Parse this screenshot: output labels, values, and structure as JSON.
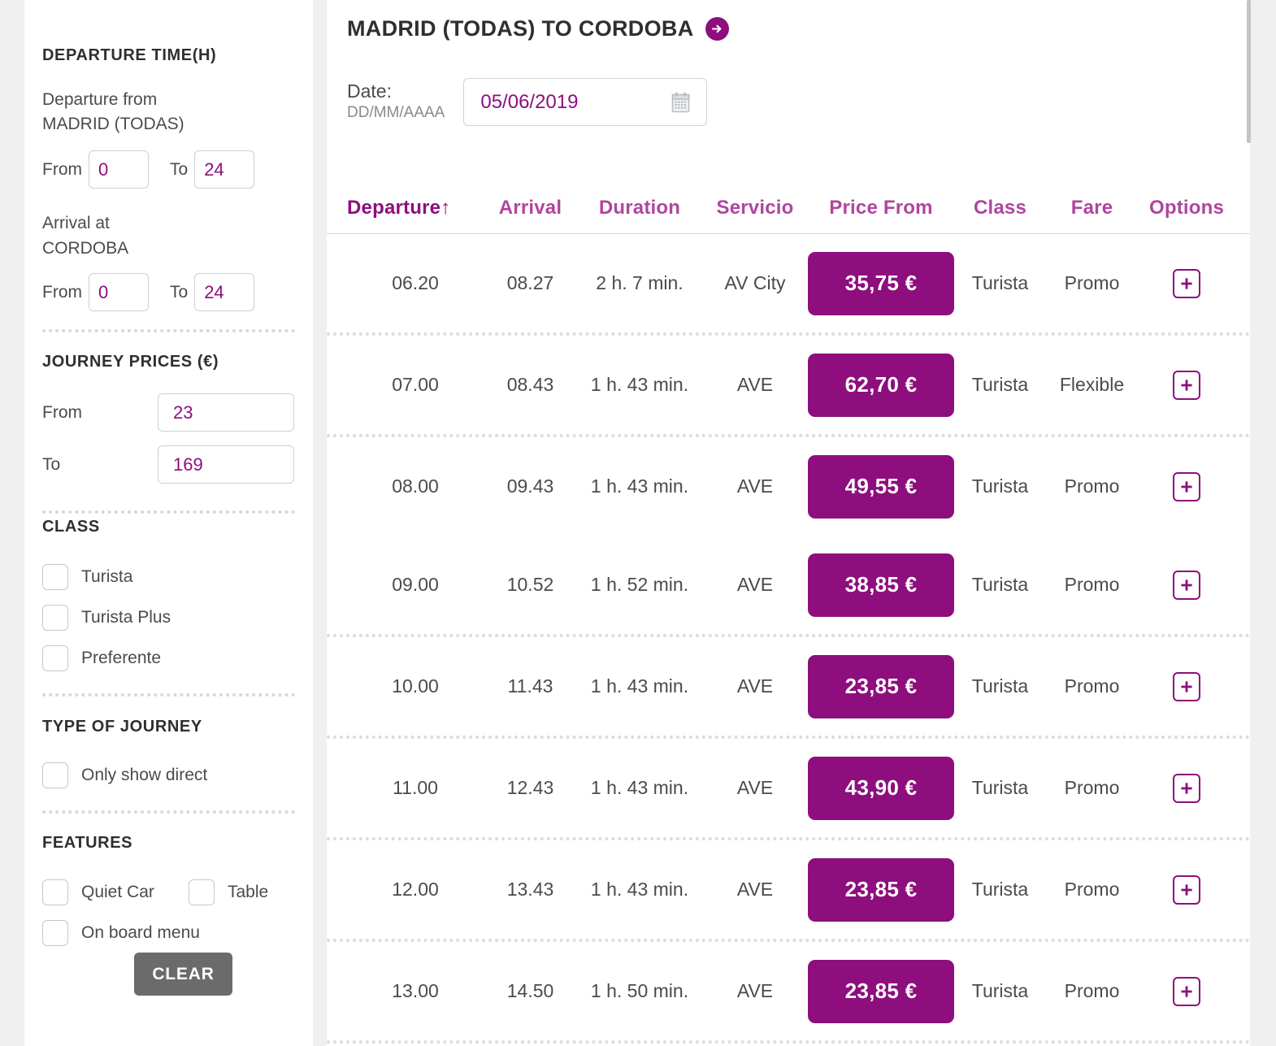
{
  "sidebar": {
    "departure_time": {
      "heading": "DEPARTURE TIME(H)",
      "departure_from_label": "Departure from",
      "departure_from_station": "MADRID (TODAS)",
      "dep_from_label": "From",
      "dep_from_value": "0",
      "dep_to_label": "To",
      "dep_to_value": "24",
      "arrival_at_label": "Arrival at",
      "arrival_at_station": "CORDOBA",
      "arr_from_label": "From",
      "arr_from_value": "0",
      "arr_to_label": "To",
      "arr_to_value": "24"
    },
    "journey_prices": {
      "heading": "JOURNEY PRICES (€)",
      "from_label": "From",
      "from_value": "23",
      "to_label": "To",
      "to_value": "169"
    },
    "class": {
      "heading": "CLASS",
      "options": [
        {
          "label": "Turista",
          "checked": false
        },
        {
          "label": "Turista Plus",
          "checked": false
        },
        {
          "label": "Preferente",
          "checked": false
        }
      ]
    },
    "type_of_journey": {
      "heading": "TYPE OF JOURNEY",
      "options": [
        {
          "label": "Only show direct",
          "checked": false
        }
      ]
    },
    "features": {
      "heading": "FEATURES",
      "options": [
        {
          "label": "Quiet Car",
          "checked": false
        },
        {
          "label": "Table",
          "checked": false
        },
        {
          "label": "On board menu",
          "checked": false
        }
      ]
    },
    "clear_button": "CLEAR"
  },
  "main": {
    "title": "MADRID (TODAS) TO CORDOBA",
    "title_arrow_icon": "arrow-right-circle-icon",
    "date": {
      "label_line1": "Date:",
      "label_line2": "DD/MM/AAAA",
      "value": "05/06/2019",
      "calendar_icon": "calendar-icon"
    },
    "table": {
      "headers": [
        {
          "label": "Departure",
          "sort": "↑",
          "active": true
        },
        {
          "label": "Arrival",
          "active": false
        },
        {
          "label": "Duration",
          "active": false
        },
        {
          "label": "Servicio",
          "active": false
        },
        {
          "label": "Price From",
          "active": false
        },
        {
          "label": "Class",
          "active": false
        },
        {
          "label": "Fare",
          "active": false
        },
        {
          "label": "Options",
          "active": false
        }
      ],
      "rows": [
        {
          "departure": "06.20",
          "arrival": "08.27",
          "duration": "2 h. 7 min.",
          "servicio": "AV City",
          "price": "35,75 €",
          "class": "Turista",
          "fare": "Promo",
          "options_icon": "plus-icon",
          "separator_after": true
        },
        {
          "departure": "07.00",
          "arrival": "08.43",
          "duration": "1 h. 43 min.",
          "servicio": "AVE",
          "price": "62,70 €",
          "class": "Turista",
          "fare": "Flexible",
          "options_icon": "plus-icon",
          "separator_after": true
        },
        {
          "departure": "08.00",
          "arrival": "09.43",
          "duration": "1 h. 43 min.",
          "servicio": "AVE",
          "price": "49,55 €",
          "class": "Turista",
          "fare": "Promo",
          "options_icon": "plus-icon",
          "separator_after": false
        },
        {
          "departure": "09.00",
          "arrival": "10.52",
          "duration": "1 h. 52 min.",
          "servicio": "AVE",
          "price": "38,85 €",
          "class": "Turista",
          "fare": "Promo",
          "options_icon": "plus-icon",
          "separator_after": true
        },
        {
          "departure": "10.00",
          "arrival": "11.43",
          "duration": "1 h. 43 min.",
          "servicio": "AVE",
          "price": "23,85 €",
          "class": "Turista",
          "fare": "Promo",
          "options_icon": "plus-icon",
          "separator_after": true
        },
        {
          "departure": "11.00",
          "arrival": "12.43",
          "duration": "1 h. 43 min.",
          "servicio": "AVE",
          "price": "43,90 €",
          "class": "Turista",
          "fare": "Promo",
          "options_icon": "plus-icon",
          "separator_after": true
        },
        {
          "departure": "12.00",
          "arrival": "13.43",
          "duration": "1 h. 43 min.",
          "servicio": "AVE",
          "price": "23,85 €",
          "class": "Turista",
          "fare": "Promo",
          "options_icon": "plus-icon",
          "separator_after": true
        },
        {
          "departure": "13.00",
          "arrival": "14.50",
          "duration": "1 h. 50 min.",
          "servicio": "AVE",
          "price": "23,85 €",
          "class": "Turista",
          "fare": "Promo",
          "options_icon": "plus-icon",
          "separator_after": true
        }
      ]
    }
  },
  "colors": {
    "accent": "#8E0E7E",
    "accent_light": "#b0459f",
    "text": "#4b4b4b",
    "heading": "#2f2f2f",
    "clear_button_bg": "#6b6b6b",
    "page_bg": "#f0f0f0"
  }
}
